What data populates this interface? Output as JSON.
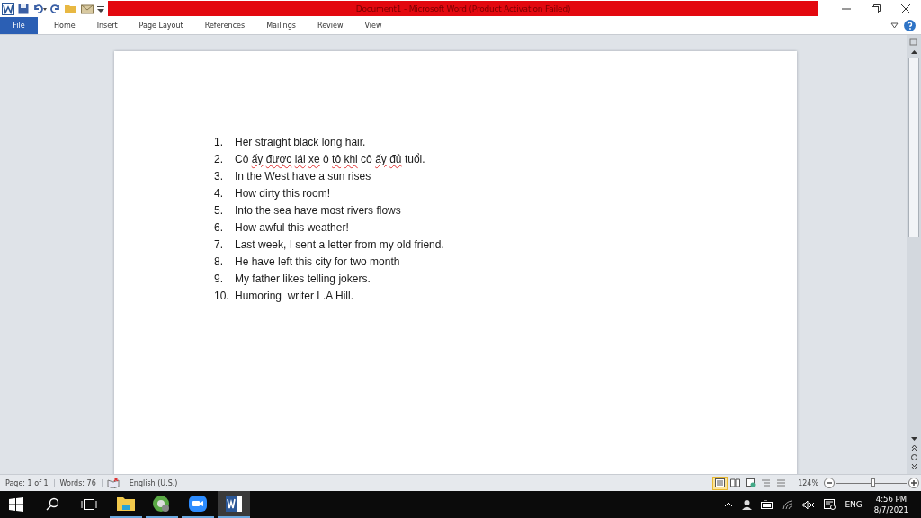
{
  "window": {
    "title": "Document1  -  Microsoft Word (Product Activation Failed)"
  },
  "ribbon_tabs": [
    {
      "label": "File",
      "selected": true
    },
    {
      "label": "Home",
      "selected": false
    },
    {
      "label": "Insert",
      "selected": false
    },
    {
      "label": "Page Layout",
      "selected": false
    },
    {
      "label": "References",
      "selected": false
    },
    {
      "label": "Mailings",
      "selected": false
    },
    {
      "label": "Review",
      "selected": false
    },
    {
      "label": "View",
      "selected": false
    }
  ],
  "document": {
    "list": [
      {
        "number": "1.",
        "words": [
          {
            "text": "Her straight black long hair.",
            "flagged": false
          }
        ]
      },
      {
        "number": "2.",
        "words": [
          {
            "text": "Cô",
            "flagged": false
          },
          {
            "text": "ấy",
            "flagged": true
          },
          {
            "text": "được",
            "flagged": true
          },
          {
            "text": "lái",
            "flagged": true
          },
          {
            "text": "xe",
            "flagged": true
          },
          {
            "text": "ô",
            "flagged": false
          },
          {
            "text": "tô",
            "flagged": true
          },
          {
            "text": "khi",
            "flagged": true
          },
          {
            "text": "cô",
            "flagged": false
          },
          {
            "text": "ấy",
            "flagged": true
          },
          {
            "text": "đủ",
            "flagged": true
          },
          {
            "text": "tuổi.",
            "flagged": false
          }
        ]
      },
      {
        "number": "3.",
        "words": [
          {
            "text": "In the West have a sun rises",
            "flagged": false
          }
        ]
      },
      {
        "number": "4.",
        "words": [
          {
            "text": "How dirty this room!",
            "flagged": false
          }
        ]
      },
      {
        "number": "5.",
        "words": [
          {
            "text": "Into the sea have most rivers flows",
            "flagged": false
          }
        ]
      },
      {
        "number": "6.",
        "words": [
          {
            "text": "How awful this weather!",
            "flagged": false
          }
        ]
      },
      {
        "number": "7.",
        "words": [
          {
            "text": "Last week, I sent a letter from my old friend.",
            "flagged": false
          }
        ]
      },
      {
        "number": "8.",
        "words": [
          {
            "text": "He have left this city for two month",
            "flagged": false
          }
        ]
      },
      {
        "number": "9.",
        "words": [
          {
            "text": "My father likes telling jokers.",
            "flagged": false
          }
        ]
      },
      {
        "number": "10.",
        "words": [
          {
            "text": "Humoring  writer L.A Hill.",
            "flagged": false
          }
        ]
      }
    ]
  },
  "status_bar": {
    "page": "Page: 1 of 1",
    "words": "Words: 76",
    "language": "English (U.S.)",
    "views": [
      {
        "kind": "print",
        "selected": true
      },
      {
        "kind": "reading",
        "selected": false
      },
      {
        "kind": "web",
        "selected": false
      },
      {
        "kind": "outline",
        "selected": false
      },
      {
        "kind": "draft",
        "selected": false
      }
    ],
    "zoom": "124%",
    "zoom_level": {
      "level": 0.52
    }
  },
  "taskbar": {
    "apps": [
      {
        "kind": "explorer",
        "selected": false
      },
      {
        "kind": "chrome",
        "selected": false
      },
      {
        "kind": "zoom",
        "selected": false
      },
      {
        "kind": "word",
        "selected": true
      }
    ],
    "language": "ENG",
    "time": "4:56 PM",
    "date": "8/7/2021"
  }
}
